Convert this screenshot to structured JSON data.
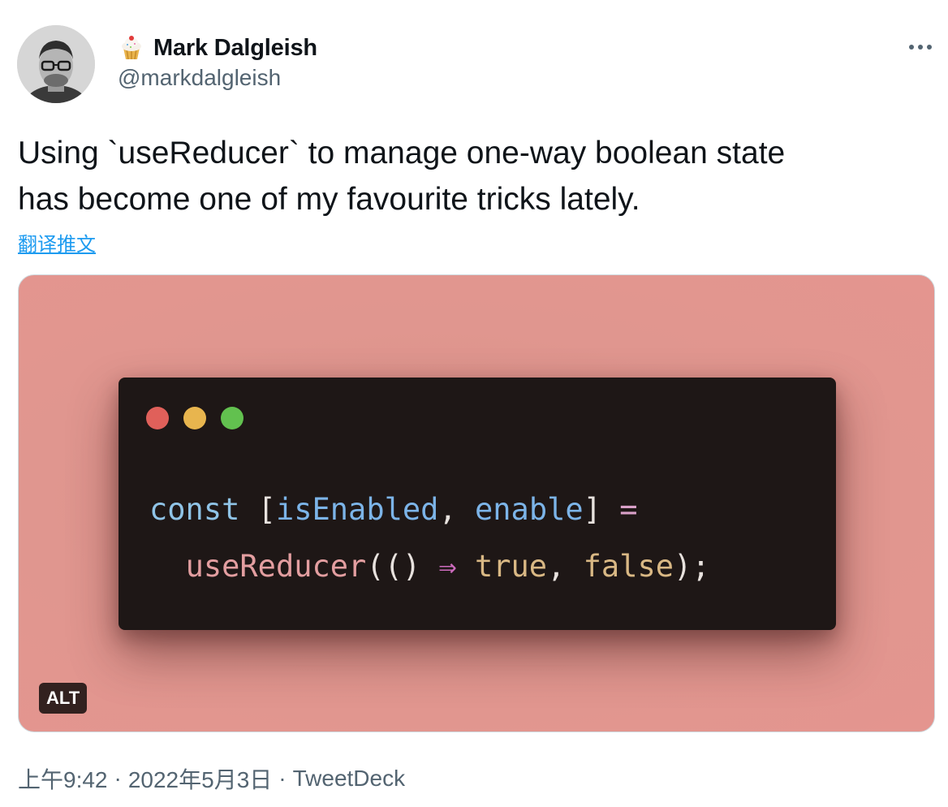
{
  "author": {
    "display_name": "Mark Dalgleish",
    "handle": "@markdalgleish",
    "emoji": "cupcake-emoji"
  },
  "menu": {
    "icon": "more-horizontal-icon"
  },
  "tweet": {
    "text_line_1": "Using `useReducer` to manage one-way boolean state",
    "text_line_2": "has become one of my favourite tricks lately.",
    "translate_label": "翻译推文"
  },
  "media": {
    "code_line_1": {
      "const": "const",
      "open_bracket": " [",
      "is_enabled": "isEnabled",
      "comma_1": ", ",
      "enable": "enable",
      "close_bracket": "]",
      "equals": " ="
    },
    "code_line_2": {
      "indent": "  ",
      "use_reducer": "useReducer",
      "parens": "(()",
      "arrow": " ⇒ ",
      "true_kw": "true",
      "comma_2": ", ",
      "false_kw": "false",
      "end": ");"
    },
    "alt_label": "ALT",
    "colors": {
      "background": "#e0968f",
      "window": "#1e1716",
      "dot_red": "#e0605a",
      "dot_yellow": "#e8b54e",
      "dot_green": "#62c14f",
      "keyword": "#8fc3e6",
      "identifier": "#7cb4e8",
      "operator": "#d9a0c8",
      "function": "#e39ea0",
      "arrow": "#cf6cbf",
      "literal": "#d9b884",
      "punct": "#e8e2de"
    }
  },
  "footer": {
    "time": "上午9:42",
    "separator_1": "·",
    "date": "2022年5月3日",
    "separator_2": "·",
    "source": "TweetDeck"
  }
}
